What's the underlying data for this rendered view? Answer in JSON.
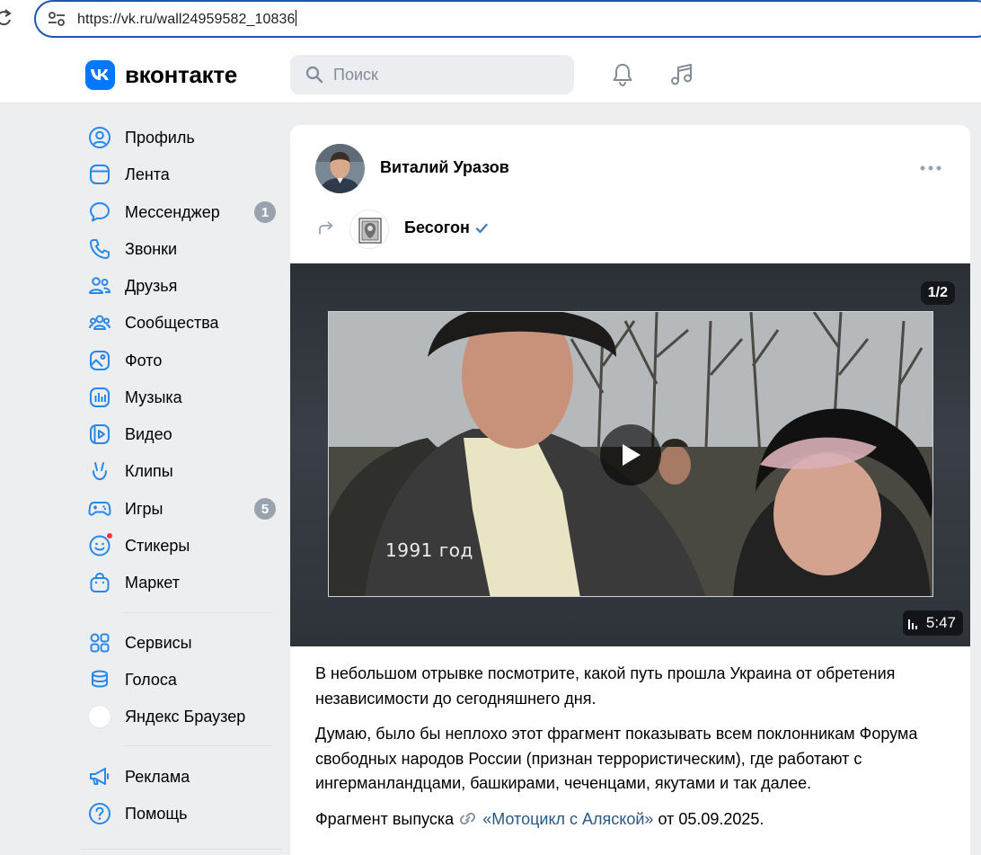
{
  "browser": {
    "url": "https://vk.ru/wall24959582_10836"
  },
  "header": {
    "logo_text": "вконтакте",
    "search_placeholder": "Поиск"
  },
  "sidebar": {
    "items": [
      {
        "label": "Профиль",
        "icon": "profile-icon"
      },
      {
        "label": "Лента",
        "icon": "feed-icon"
      },
      {
        "label": "Мессенджер",
        "icon": "messenger-icon",
        "badge": "1"
      },
      {
        "label": "Звонки",
        "icon": "phone-icon"
      },
      {
        "label": "Друзья",
        "icon": "friends-icon"
      },
      {
        "label": "Сообщества",
        "icon": "communities-icon"
      },
      {
        "label": "Фото",
        "icon": "photo-icon"
      },
      {
        "label": "Музыка",
        "icon": "music-icon"
      },
      {
        "label": "Видео",
        "icon": "video-icon"
      },
      {
        "label": "Клипы",
        "icon": "clips-icon"
      },
      {
        "label": "Игры",
        "icon": "games-icon",
        "badge": "5"
      },
      {
        "label": "Стикеры",
        "icon": "stickers-icon"
      },
      {
        "label": "Маркет",
        "icon": "market-icon"
      },
      {
        "label": "Сервисы",
        "icon": "services-icon"
      },
      {
        "label": "Голоса",
        "icon": "votes-icon"
      },
      {
        "label": "Яндекс Браузер",
        "icon": "yandex-browser-icon"
      },
      {
        "label": "Реклама",
        "icon": "ads-icon"
      },
      {
        "label": "Помощь",
        "icon": "help-icon"
      }
    ]
  },
  "post": {
    "author": "Виталий Уразов",
    "source": "Бесогон",
    "video": {
      "counter": "1/2",
      "caption": "1991 год",
      "duration": "5:47"
    },
    "text": {
      "p1": "В небольшом отрывке посмотрите, какой путь прошла Украина от обретения независимости до сегодняшнего дня.",
      "p2": "Думаю, было бы неплохо этот фрагмент показывать всем поклонникам Форума свободных народов России (признан террористическим), где работают с ингерманландцами, башкирами, чеченцами, якутами и так далее.",
      "p3_prefix": "Фрагмент выпуска",
      "p3_link": "«Мотоцикл с Аляской»",
      "p3_suffix": "от 05.09.2025."
    }
  },
  "colors": {
    "accent": "#0077ff",
    "link": "#2a5885",
    "badge": "#99a2ad",
    "background": "#edeef0"
  }
}
